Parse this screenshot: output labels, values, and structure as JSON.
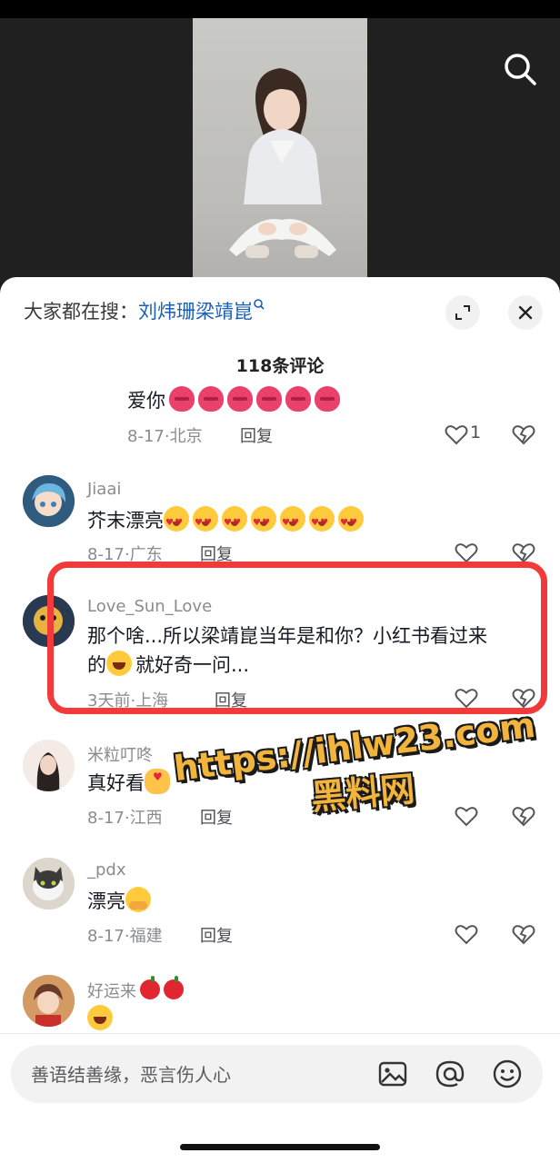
{
  "sheet": {
    "hot_search_prefix": "大家都在搜：",
    "hot_search_term": "刘炜珊梁靖崑",
    "comment_count": "118条评论"
  },
  "comments": [
    {
      "username": "",
      "text": "爱你",
      "emojis": [
        "kiss",
        "kiss",
        "kiss",
        "kiss",
        "kiss",
        "kiss",
        "kiss"
      ],
      "date": "8-17",
      "location": "北京",
      "reply": "回复",
      "likes": "1"
    },
    {
      "username": "Jiaai",
      "text": "芥末漂亮",
      "emojis": [
        "love-eyes",
        "love-eyes",
        "love-eyes",
        "love-eyes",
        "love-eyes",
        "love-eyes",
        "love-eyes"
      ],
      "date": "8-17",
      "location": "广东",
      "reply": "回复",
      "likes": ""
    },
    {
      "username": "Love_Sun_Love",
      "text_line1": "那个啥...所以梁靖崑当年是和你？小红书看过来",
      "text_line2_a": "的",
      "text_line2_b": "就好奇一问...",
      "date": "3天前",
      "location": "上海",
      "reply": "回复",
      "likes": ""
    },
    {
      "username": "米粒叮咚",
      "text": "真好看",
      "date": "8-17",
      "location": "江西",
      "reply": "回复",
      "likes": ""
    },
    {
      "username": "_pdx",
      "text": "漂亮",
      "date": "8-17",
      "location": "福建",
      "reply": "回复",
      "likes": ""
    },
    {
      "username": "好运来",
      "text": "",
      "date": "",
      "location": "",
      "reply": "",
      "likes": ""
    }
  ],
  "meta_sep": "·",
  "watermark": {
    "url": "https://ihlw23.com",
    "site": "黑料网"
  },
  "input": {
    "placeholder": "善语结善缘，恶言伤人心"
  },
  "icons": [
    "search-icon",
    "expand-icon",
    "close-icon",
    "heart-icon",
    "broken-heart-icon",
    "image-icon",
    "at-icon",
    "emoji-icon"
  ],
  "colors": {
    "highlight": "#f33a3a",
    "link": "#1a5fb4",
    "watermark": "#f2b43a"
  }
}
